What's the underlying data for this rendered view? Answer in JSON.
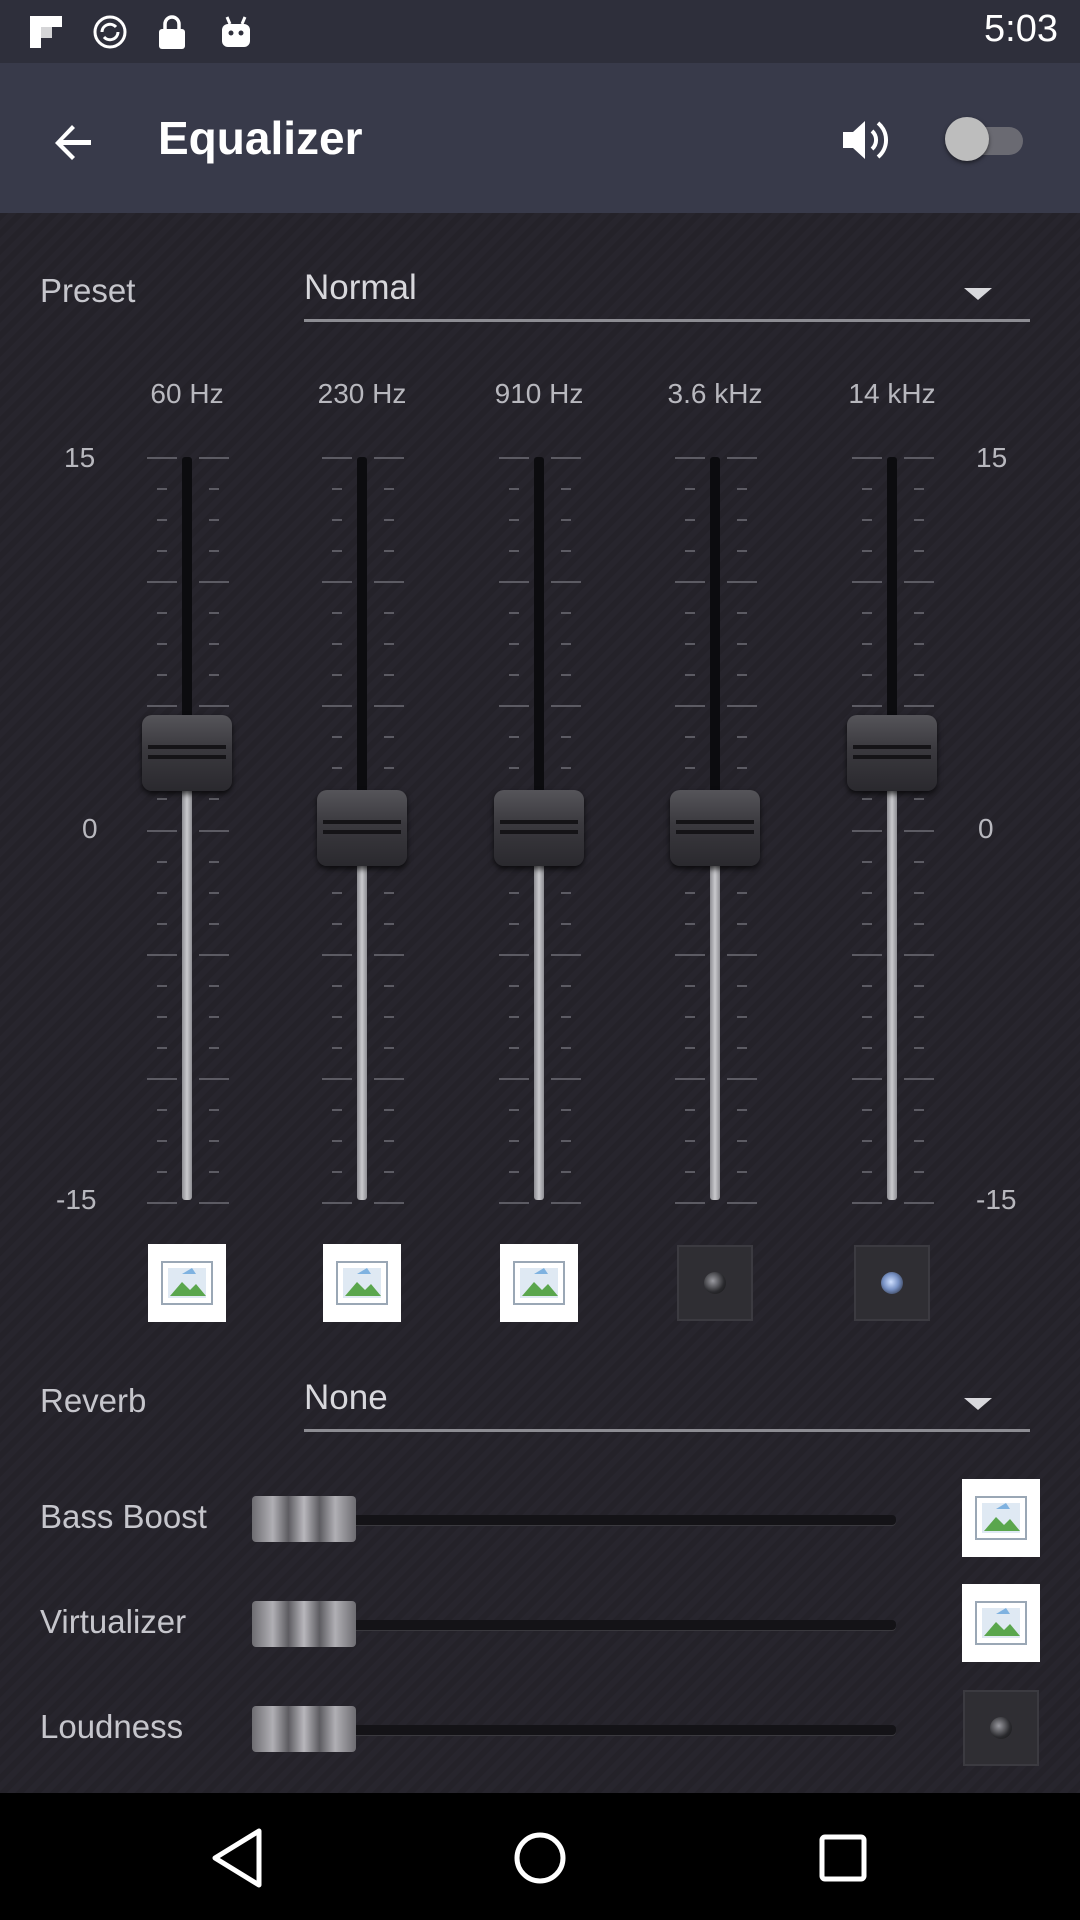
{
  "status_bar": {
    "time": "5:03",
    "icons": [
      "flipboard-icon",
      "sync-icon",
      "lock-icon",
      "android-icon"
    ]
  },
  "app_bar": {
    "title": "Equalizer",
    "back_icon": "arrow-back-icon",
    "volume_icon": "volume-up-icon",
    "toggle_on": false
  },
  "preset": {
    "label": "Preset",
    "value": "Normal"
  },
  "equalizer": {
    "scale": {
      "max": "15",
      "mid": "0",
      "min": "-15"
    },
    "bands": [
      {
        "freq": "60 Hz",
        "level": 3,
        "button": "image-placeholder"
      },
      {
        "freq": "230 Hz",
        "level": 0,
        "button": "image-placeholder"
      },
      {
        "freq": "910 Hz",
        "level": 0,
        "button": "image-placeholder"
      },
      {
        "freq": "3.6 kHz",
        "level": 0,
        "button": "dark-dot"
      },
      {
        "freq": "14 kHz",
        "level": 3,
        "button": "dark-dot-blue"
      }
    ]
  },
  "reverb": {
    "label": "Reverb",
    "value": "None"
  },
  "effects": [
    {
      "label": "Bass Boost",
      "value": 0,
      "button": "image-placeholder"
    },
    {
      "label": "Virtualizer",
      "value": 0,
      "button": "image-placeholder"
    },
    {
      "label": "Loudness",
      "value": 0,
      "button": "dark-dot"
    }
  ],
  "nav_bar": {
    "icons": [
      "back-triangle-icon",
      "home-circle-icon",
      "recents-square-icon"
    ]
  },
  "colors": {
    "app_bar": "#383a4a",
    "status_bar": "#2e2f3b",
    "background": "#25232b"
  }
}
